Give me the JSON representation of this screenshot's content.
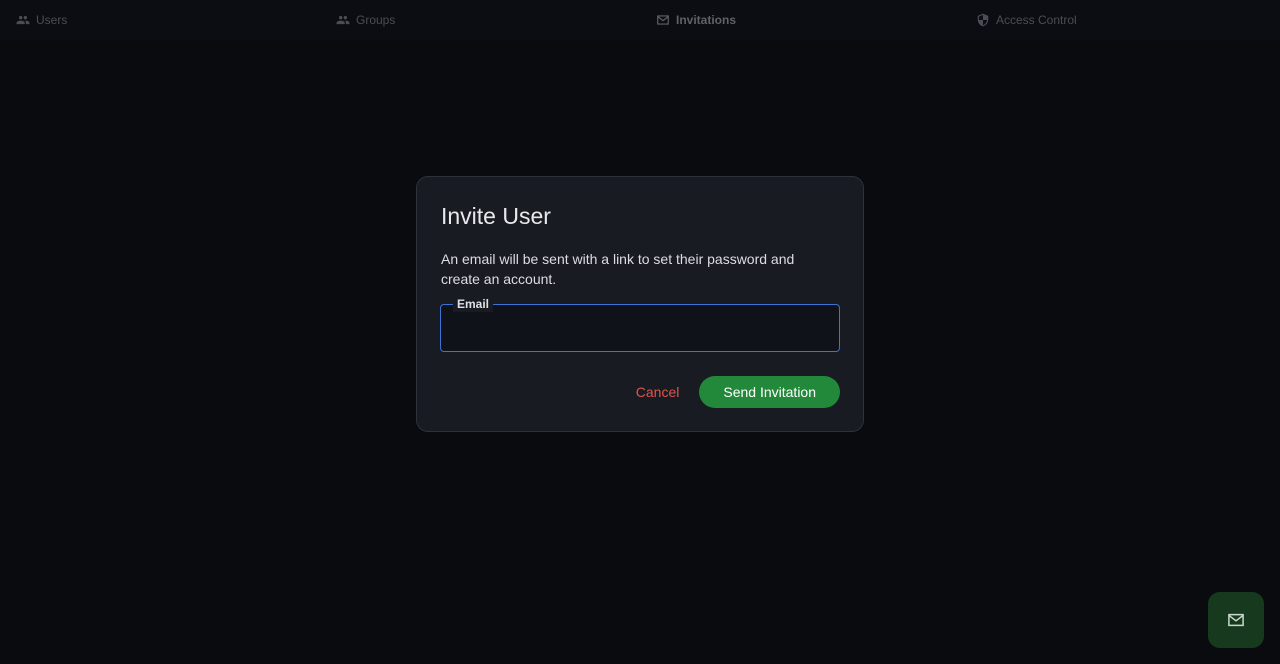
{
  "tabs": [
    {
      "label": "Users",
      "icon": "people-icon",
      "active": false
    },
    {
      "label": "Groups",
      "icon": "people-icon",
      "active": false
    },
    {
      "label": "Invitations",
      "icon": "mail-icon",
      "active": true
    },
    {
      "label": "Access Control",
      "icon": "shield-icon",
      "active": false
    }
  ],
  "dialog": {
    "title": "Invite User",
    "description": "An email will be sent with a link to set their password and create an account.",
    "email_label": "Email",
    "email_value": "",
    "cancel_label": "Cancel",
    "send_label": "Send Invitation"
  },
  "fab": {
    "icon": "mail-icon"
  },
  "colors": {
    "background": "#0a0b0f",
    "dialog_bg": "#181b22",
    "accent_blue": "#3d73d6",
    "send_green": "#22883a",
    "cancel_red": "#e5534b",
    "fab_bg": "#173a1f"
  }
}
